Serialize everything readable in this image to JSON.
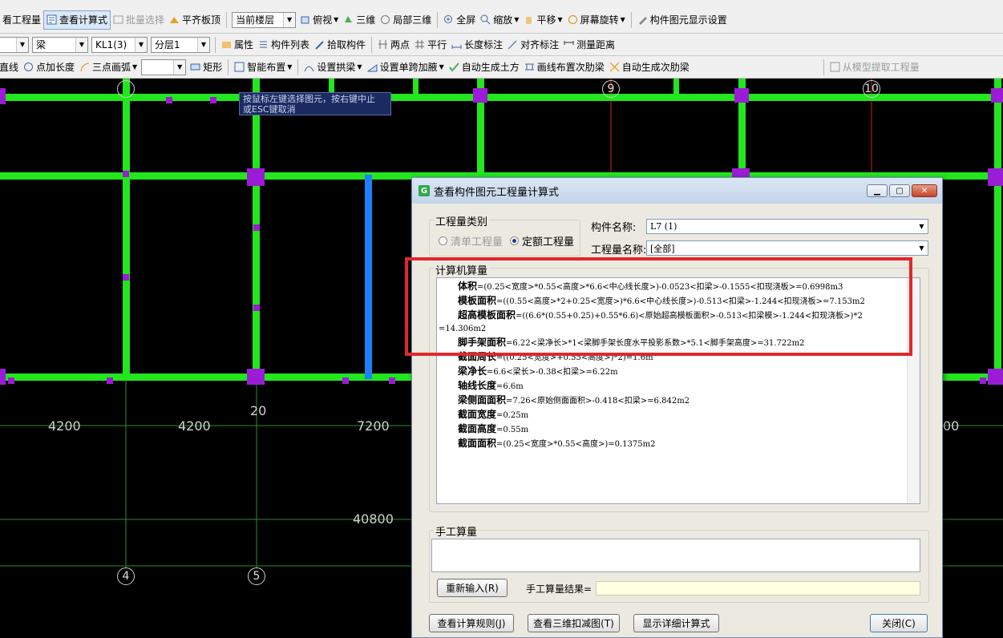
{
  "toolbar1": {
    "items": [
      "看工程量",
      "查看计算式",
      "批量选择",
      "平齐板顶"
    ],
    "floor_combo": "当前楼层",
    "view_items": [
      "俯视",
      "三维",
      "局部三维",
      "全屏",
      "缩放",
      "平移",
      "屏幕旋转",
      "构件图元显示设置"
    ]
  },
  "toolbar2": {
    "combo_type": "梁",
    "combo_name": "KL1(3)",
    "combo_layer": "分层1",
    "items": [
      "属性",
      "构件列表",
      "拾取构件",
      "两点",
      "平行",
      "长度标注",
      "对齐标注",
      "测量距离"
    ]
  },
  "toolbar3": {
    "items": [
      "直线",
      "点加长度",
      "三点画弧",
      "矩形",
      "智能布置",
      "设置拱梁",
      "设置单跨加腋",
      "自动生成土方",
      "画线布置次肋梁",
      "自动生成次肋梁",
      "从模型提取工程量"
    ]
  },
  "canvas": {
    "tooltip_line1": "按鼠标左键选择图元，按右键中止",
    "tooltip_line2": "或ESC键取消",
    "dims": [
      "4200",
      "4200",
      "7200",
      "00",
      "40800",
      "20"
    ],
    "axis_top": [
      "9",
      "10"
    ],
    "axis_bottom": [
      "4",
      "5"
    ],
    "colors": {
      "beam": "#22e61e",
      "selected": "#1e7fff",
      "column": "#9b1bd6",
      "axis": "#d11f1f"
    }
  },
  "dialog": {
    "title": "查看构件图元工程量计算式",
    "type_group_label": "工程量类别",
    "radio_qd": "清单工程量",
    "radio_de": "定额工程量",
    "component_label": "构件名称:",
    "component_value": "L7 (1)",
    "quantity_label": "工程量名称:",
    "quantity_value": "[全部]",
    "calc_label": "计算机算量",
    "calc_lines": [
      {
        "name": "体积",
        "expr": "=(0.25<宽度>*0.55<高度>*6.6<中心线长度>)-0.0523<扣梁>-0.1555<扣现浇板>=0.6998m3"
      },
      {
        "name": "模板面积",
        "expr": "=((0.55<高度>*2+0.25<宽度>)*6.6<中心线长度>)-0.513<扣梁>-1.244<扣现浇板>=7.153m2"
      },
      {
        "name": "超高模板面积",
        "expr": "=((6.6*(0.55+0.25)+0.55*6.6)<原始超高模板面积>-0.513<扣梁模>-1.244<扣现浇板>)*2"
      },
      {
        "name": "",
        "expr": "=14.306m2"
      },
      {
        "name": "脚手架面积",
        "expr": "=6.22<梁净长>*1<梁脚手架长度水平投影系数>*5.1<脚手架高度>=31.722m2"
      },
      {
        "name": "截面周长",
        "expr": "=((0.25<宽度>+0.55<高度>)*2)=1.6m"
      },
      {
        "name": "梁净长",
        "expr": "=6.6<梁长>-0.38<扣梁>=6.22m"
      },
      {
        "name": "轴线长度",
        "expr": "=6.6m"
      },
      {
        "name": "梁侧面面积",
        "expr": "=7.26<原始侧面面积>-0.418<扣梁>=6.842m2"
      },
      {
        "name": "截面宽度",
        "expr": "=0.25m"
      },
      {
        "name": "截面高度",
        "expr": "=0.55m"
      },
      {
        "name": "截面面积",
        "expr": "=(0.25<宽度>*0.55<高度>)=0.1375m2"
      }
    ],
    "manual_label": "手工算量",
    "reinput_button": "重新输入(R)",
    "manual_result_label": "手工算量结果=",
    "btn_rules": "查看计算规则(J)",
    "btn_3d": "查看三维扣减图(T)",
    "btn_detail": "显示详细计算式",
    "btn_close": "关闭(C)"
  }
}
